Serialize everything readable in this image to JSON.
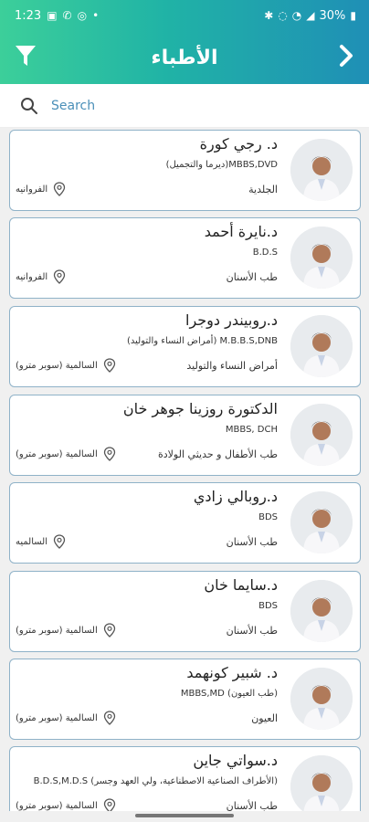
{
  "status_bar": {
    "time": "1:23",
    "battery": "30%"
  },
  "header": {
    "title": "الأطباء",
    "filter_icon": "filter-icon",
    "back_icon": "chevron-right-icon",
    "gradient_start": "#3ccf9a",
    "gradient_end": "#1f8fb6"
  },
  "search": {
    "placeholder": "Search"
  },
  "doctors": [
    {
      "name": "د. رجي كورة",
      "quals": "(ديرما والتجميل)MBBS,DVD",
      "specialty": "الجلدية",
      "location": "الفروانيه"
    },
    {
      "name": "د.نايرة أحمد",
      "quals": "B.D.S",
      "specialty": "طب الأسنان",
      "location": "الفروانيه"
    },
    {
      "name": "د.روبيندر دوجرا",
      "quals": "(أمراض النساء والتوليد) M.B.B.S,DNB",
      "specialty": "أمراض النساء والتوليد",
      "location": "السالمية (سوبر مترو)"
    },
    {
      "name": "الدكتورة روزينا جوهر خان",
      "quals": "MBBS, DCH",
      "specialty": "طب الأطفال و حديثي الولادة",
      "location": "السالمية (سوبر مترو)"
    },
    {
      "name": "د.روبالي زادي",
      "quals": "BDS",
      "specialty": "طب الأسنان",
      "location": "السالميه"
    },
    {
      "name": "د.سايما خان",
      "quals": "BDS",
      "specialty": "طب الأسنان",
      "location": "السالمية (سوبر مترو)"
    },
    {
      "name": "د. شبير كونهمد",
      "quals": "MBBS,MD (طب العيون)",
      "specialty": "العيون",
      "location": "السالمية (سوبر مترو)"
    },
    {
      "name": "د.سواتي جاين",
      "quals": "B.D.S,M.D.S (الأطراف الصناعية الاصطناعية، ولي العهد وجسر)",
      "specialty": "طب الأسنان",
      "location": "السالمية (سوبر مترو)"
    }
  ],
  "colors": {
    "card_border": "#8fb2c8",
    "accent_text": "#3a8fb6"
  }
}
